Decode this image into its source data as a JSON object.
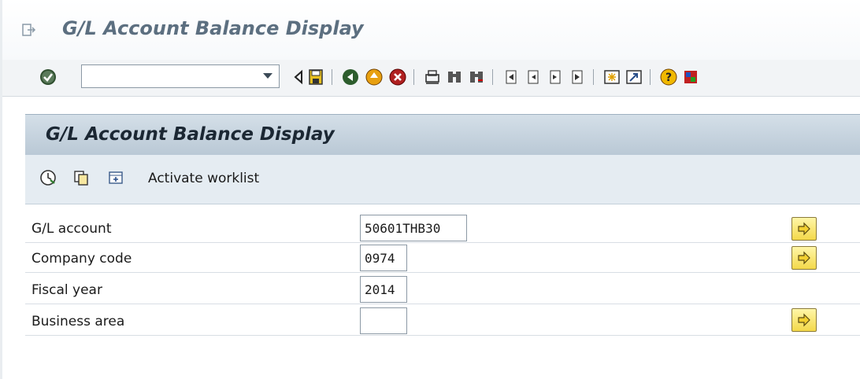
{
  "window": {
    "title": "G/L Account Balance Display"
  },
  "toolbar": {
    "command_field_value": "",
    "icons": [
      "enter-icon",
      "back-triangle-icon",
      "save-icon",
      "back-icon",
      "exit-icon",
      "cancel-icon",
      "print-icon",
      "find-icon",
      "find-next-icon",
      "first-page-icon",
      "previous-page-icon",
      "next-page-icon",
      "last-page-icon",
      "create-session-icon",
      "shortcut-icon",
      "help-icon",
      "customize-icon"
    ]
  },
  "app": {
    "title": "G/L Account Balance Display",
    "toolbar": {
      "icons": [
        "execute-icon",
        "get-variant-icon",
        "worklist-icon"
      ],
      "worklist_label": "Activate worklist"
    },
    "fields": [
      {
        "label": "G/L account",
        "value": "50601THB30",
        "has_button": true
      },
      {
        "label": "Company code",
        "value": "0974",
        "has_button": true
      },
      {
        "label": "Fiscal year",
        "value": "2014",
        "has_button": false
      },
      {
        "label": "Business area",
        "value": "",
        "has_button": true
      }
    ]
  },
  "colors": {
    "title_text": "#5c6f80",
    "button_yellow": "#f3d84a",
    "header_blue": "#b9c8d5"
  }
}
